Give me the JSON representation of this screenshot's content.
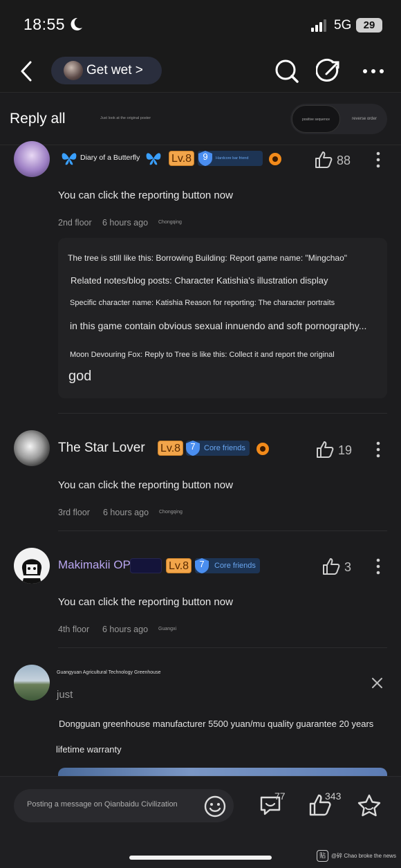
{
  "status": {
    "time": "18:55",
    "network": "5G",
    "battery": "29"
  },
  "nav": {
    "forum_title": "Get wet >"
  },
  "reply_header": {
    "title": "Reply all",
    "hint": "Just look at the original poster",
    "sort_options": [
      "positive sequence",
      "reverse order"
    ]
  },
  "comments": [
    {
      "username": "Diary of a Butterfly",
      "level": "Lv.8",
      "friend_level": "9",
      "friend_label": "Hardcore bar friend",
      "likes": "88",
      "text": "You can click the reporting button now",
      "floor": "2nd floor",
      "time": "6 hours ago",
      "location": "Chongqing",
      "quote": [
        "The tree is still like this: Borrowing Building: Report game name: \"Mingchao\"",
        "Related notes/blog posts: Character Katishia's illustration display",
        "Specific character name: Katishia Reason for reporting: The character portraits",
        "in this game contain obvious sexual innuendo and soft pornography...",
        "Moon Devouring Fox: Reply to Tree is like this: Collect it and report the original",
        "god"
      ]
    },
    {
      "username": "The Star Lover",
      "level": "Lv.8",
      "friend_level": "7",
      "friend_label": "Core friends",
      "likes": "19",
      "text": "You can click the reporting button now",
      "floor": "3rd floor",
      "time": "6 hours ago",
      "location": "Chongqing"
    },
    {
      "username": "Makimakii OP",
      "level": "Lv.8",
      "friend_level": "7",
      "friend_label": "Core friends",
      "likes": "3",
      "text": "You can click the reporting button now",
      "floor": "4th floor",
      "time": "6 hours ago",
      "location": "Guangxi"
    }
  ],
  "ad": {
    "name": "Guangyuan Agricultural Technology Greenhouse",
    "label": "just",
    "text": "Dongguan greenhouse manufacturer 5500 yuan/mu quality guarantee 20 years",
    "text2": "lifetime warranty"
  },
  "bottom_bar": {
    "placeholder": "Posting a message on Qianbaidu Civilization",
    "comment_count": "77",
    "like_count": "343"
  },
  "watermark": {
    "badge": "贴",
    "text": "@碎 Chao broke the news"
  },
  "colors": {
    "background": "#1c1c1e",
    "level_badge": "#f2a54a",
    "friend_badge": "#1d3454",
    "op_name": "#b9a6f0"
  }
}
